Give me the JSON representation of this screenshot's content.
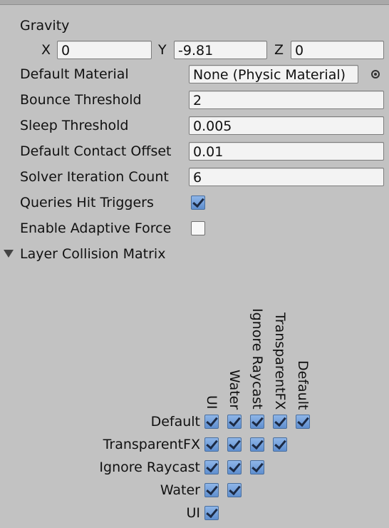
{
  "gravity": {
    "label": "Gravity",
    "x_label": "X",
    "x_value": "0",
    "y_label": "Y",
    "y_value": "-9.81",
    "z_label": "Z",
    "z_value": "0"
  },
  "fields": {
    "default_material_label": "Default Material",
    "default_material_value": "None (Physic Material)",
    "bounce_threshold_label": "Bounce Threshold",
    "bounce_threshold_value": "2",
    "sleep_threshold_label": "Sleep Threshold",
    "sleep_threshold_value": "0.005",
    "default_contact_offset_label": "Default Contact Offset",
    "default_contact_offset_value": "0.01",
    "solver_iteration_count_label": "Solver Iteration Count",
    "solver_iteration_count_value": "6",
    "queries_hit_triggers_label": "Queries Hit Triggers",
    "queries_hit_triggers_checked": true,
    "enable_adaptive_force_label": "Enable Adaptive Force",
    "enable_adaptive_force_checked": false
  },
  "matrix": {
    "title": "Layer Collision Matrix",
    "columns": [
      "UI",
      "Water",
      "Ignore Raycast",
      "TransparentFX",
      "Default"
    ],
    "rows": [
      {
        "label": "Default",
        "checked": [
          true,
          true,
          true,
          true,
          true
        ]
      },
      {
        "label": "TransparentFX",
        "checked": [
          true,
          true,
          true,
          true
        ]
      },
      {
        "label": "Ignore Raycast",
        "checked": [
          true,
          true,
          true
        ]
      },
      {
        "label": "Water",
        "checked": [
          true,
          true
        ]
      },
      {
        "label": "UI",
        "checked": [
          true
        ]
      }
    ]
  }
}
